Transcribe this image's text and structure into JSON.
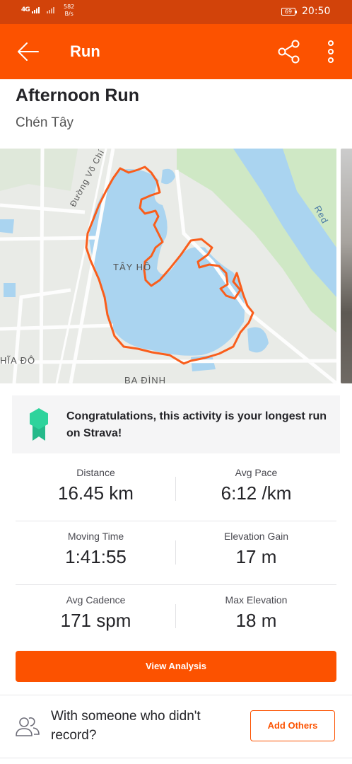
{
  "status_bar": {
    "network": "4G",
    "speed_value": "582",
    "speed_unit": "B/s",
    "battery": "69",
    "time": "20:50"
  },
  "app_bar": {
    "title": "Run",
    "back_icon": "arrow-left-icon",
    "share_icon": "share-icon",
    "more_icon": "more-vertical-icon"
  },
  "activity": {
    "title": "Afternoon Run",
    "location": "Chén Tây"
  },
  "map": {
    "labels": {
      "street": "Đường Võ Chí Công",
      "lake": "TÂY HỒ",
      "district_left": "HĨA ĐÔ",
      "district_bottom": "BA ĐÌNH",
      "river": "Red"
    },
    "route_color": "#f95e1c",
    "water_color": "#aad4f0"
  },
  "achievement": {
    "icon": "medal-icon",
    "text": "Congratulations, this activity is your longest run on Strava!"
  },
  "stats": [
    [
      {
        "label": "Distance",
        "value": "16.45 km"
      },
      {
        "label": "Avg Pace",
        "value": "6:12 /km"
      }
    ],
    [
      {
        "label": "Moving Time",
        "value": "1:41:55"
      },
      {
        "label": "Elevation Gain",
        "value": "17 m"
      }
    ],
    [
      {
        "label": "Avg Cadence",
        "value": "171 spm"
      },
      {
        "label": "Max Elevation",
        "value": "18 m"
      }
    ]
  ],
  "view_analysis_label": "View Analysis",
  "others": {
    "icon": "people-icon",
    "text": "With someone who didn't record?",
    "button_label": "Add Others"
  },
  "colors": {
    "brand": "#fc5200",
    "status_bar": "#d2430a"
  }
}
